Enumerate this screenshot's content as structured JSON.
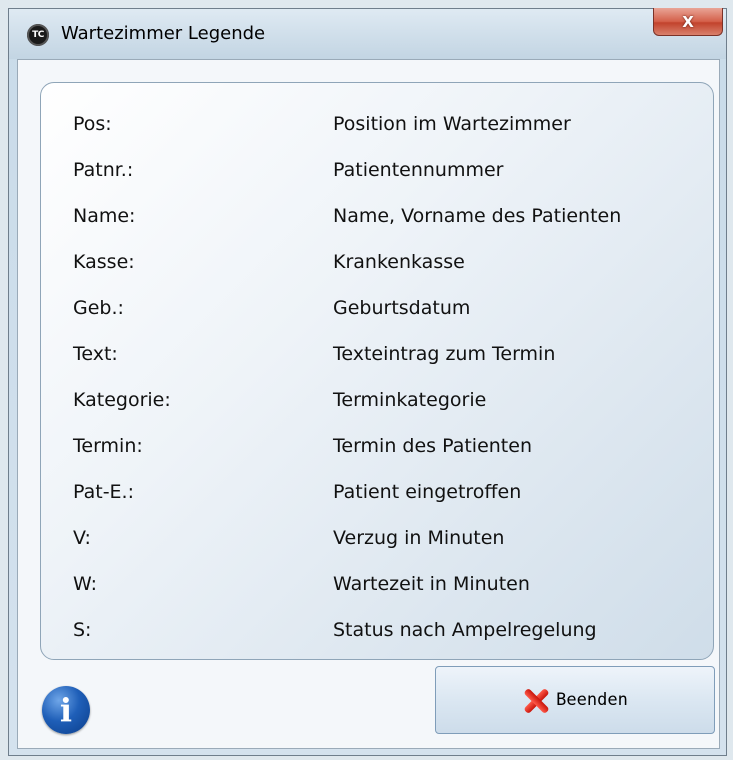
{
  "window": {
    "title": "Wartezimmer Legende",
    "app_icon_text": "TC",
    "close_glyph": "X"
  },
  "legend": [
    {
      "key": "Pos:",
      "desc": "Position im Wartezimmer"
    },
    {
      "key": "Patnr.:",
      "desc": "Patientennummer"
    },
    {
      "key": "Name:",
      "desc": "Name, Vorname des Patienten"
    },
    {
      "key": "Kasse:",
      "desc": "Krankenkasse"
    },
    {
      "key": "Geb.:",
      "desc": "Geburtsdatum"
    },
    {
      "key": "Text:",
      "desc": "Texteintrag zum Termin"
    },
    {
      "key": "Kategorie:",
      "desc": "Terminkategorie"
    },
    {
      "key": "Termin:",
      "desc": "Termin des Patienten"
    },
    {
      "key": "Pat-E.:",
      "desc": "Patient eingetroffen"
    },
    {
      "key": "V:",
      "desc": "Verzug in Minuten"
    },
    {
      "key": "W:",
      "desc": "Wartezeit in Minuten"
    },
    {
      "key": "S:",
      "desc": "Status nach Ampelregelung"
    }
  ],
  "footer": {
    "info_glyph": "i",
    "beenden_label": "Beenden"
  }
}
